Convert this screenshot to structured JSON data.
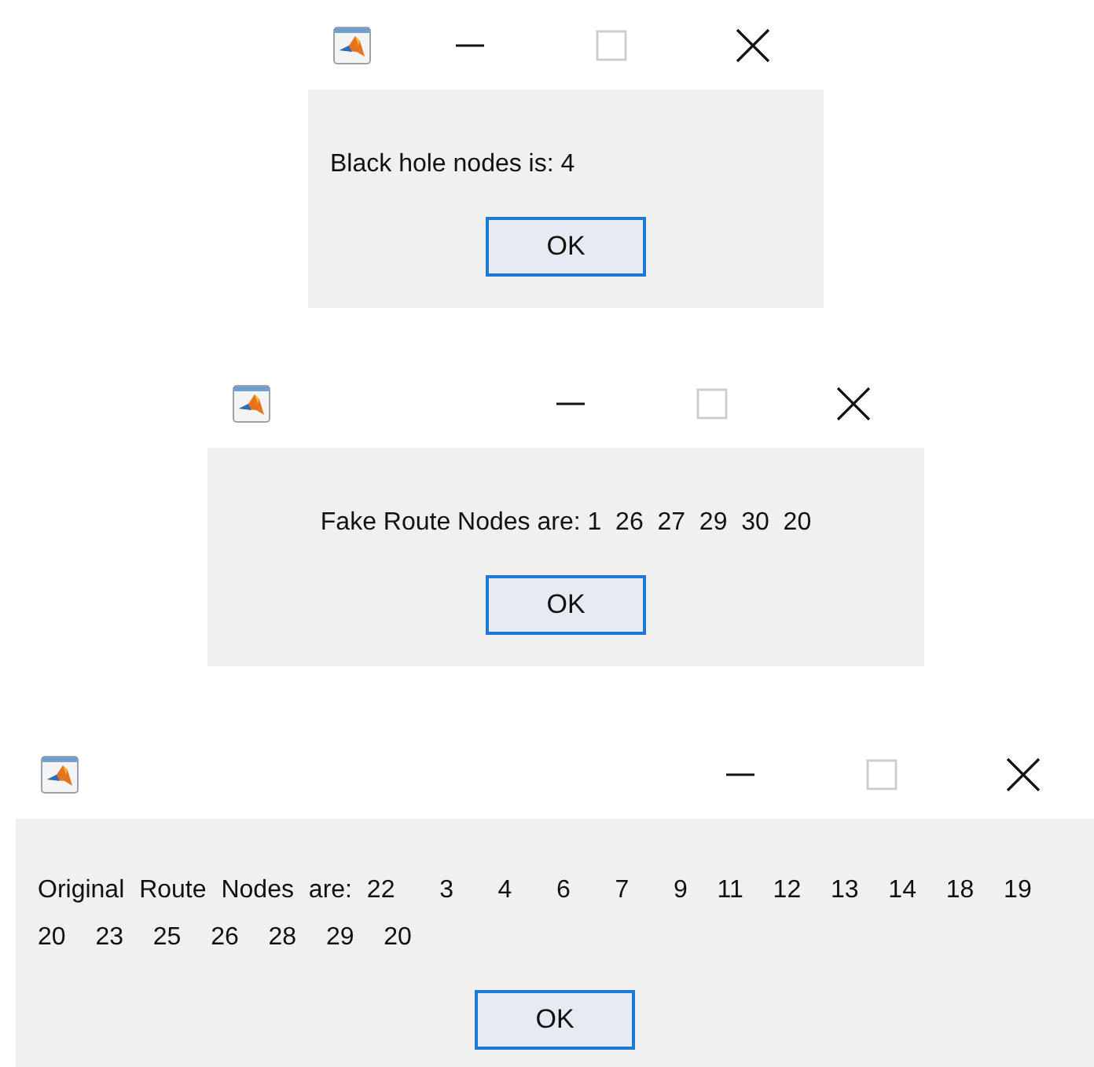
{
  "dialogs": [
    {
      "message_lines": [
        "Black hole nodes is: 4"
      ],
      "button": "OK",
      "maximize_disabled": true
    },
    {
      "message_lines": [
        "Fake Route Nodes are: 1  26  27  29  30  20"
      ],
      "button": "OK",
      "maximize_disabled": true
    },
    {
      "message_lines": [
        "Original Route Nodes are: 22   3   4   6   7   9  11  12  13  14  18  19",
        "20  23  25  26  28  29  20"
      ],
      "button": "OK",
      "maximize_disabled": true
    }
  ]
}
